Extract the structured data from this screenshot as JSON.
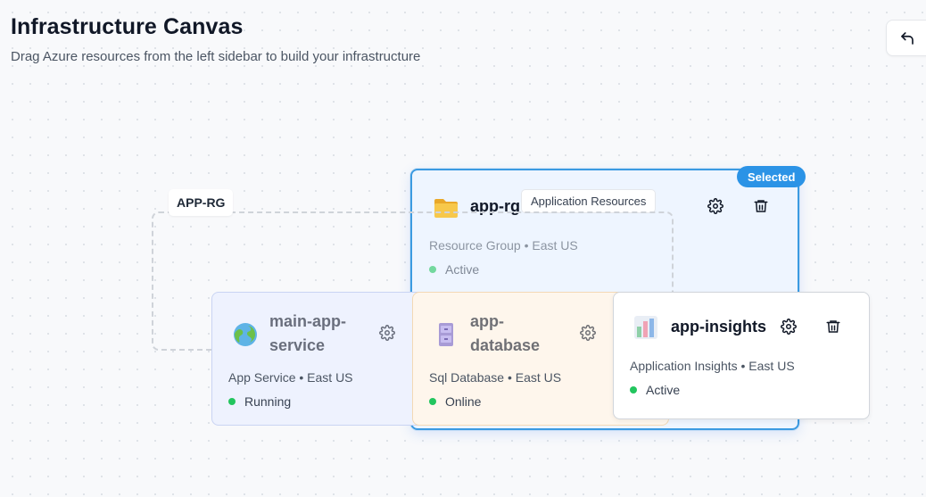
{
  "header": {
    "title": "Infrastructure Canvas",
    "subtitle": "Drag Azure resources from the left sidebar to build your infrastructure"
  },
  "toolbar": {
    "undo_icon": "undo-icon"
  },
  "group": {
    "label": "APP-RG"
  },
  "resource_group": {
    "name": "app-rg",
    "description": "Application Resources",
    "meta": "Resource Group • East US",
    "status": "Active",
    "badge": "Selected",
    "icon": "folder-icon"
  },
  "resources": [
    {
      "name": "main-app-service",
      "title_line1": "main-app-",
      "title_line2": "service",
      "meta": "App Service • East US",
      "status": "Running",
      "icon": "globe-icon"
    },
    {
      "name": "app-database",
      "title_line1": "app-",
      "title_line2": "database",
      "meta": "Sql Database • East US",
      "status": "Online",
      "icon": "database-icon"
    },
    {
      "name": "app-insights",
      "title_line1": "app-insights",
      "meta": "Application Insights • East US",
      "status": "Active",
      "icon": "insights-chart-icon"
    }
  ],
  "colors": {
    "selected": "#2b93e6",
    "status_ok": "#22c55e",
    "app_service_bg": "#eef2fe",
    "database_bg": "#fef6ec"
  }
}
